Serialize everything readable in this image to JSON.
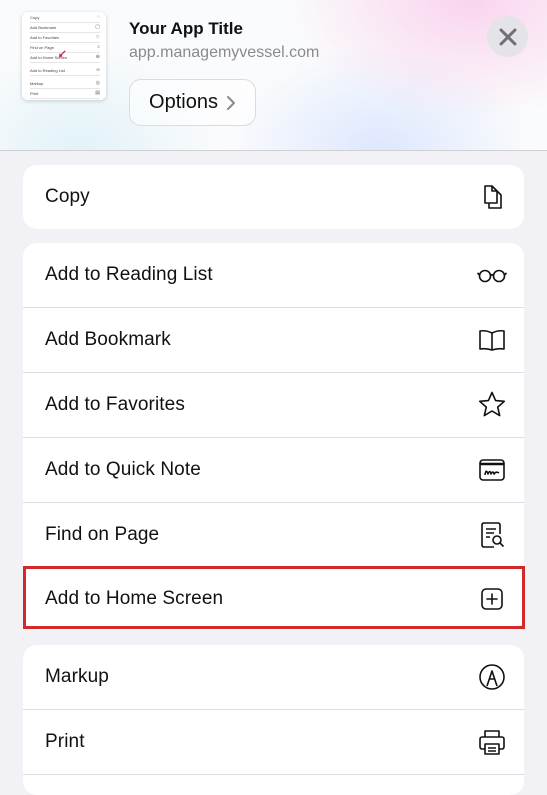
{
  "header": {
    "app_title": "Your App Title",
    "app_url": "app.managemyvessel.com",
    "options_label": "Options",
    "thumbnail": {
      "rows": [
        "Copy",
        "Add Bookmark",
        "Add to Favorites",
        "Find on Page",
        "Add to Home Screen",
        "Add to Reading List",
        "Markup",
        "Print"
      ]
    }
  },
  "groups": [
    {
      "items": [
        {
          "label": "Copy",
          "icon": "copy-icon"
        }
      ]
    },
    {
      "items": [
        {
          "label": "Add to Reading List",
          "icon": "glasses-icon"
        },
        {
          "label": "Add Bookmark",
          "icon": "book-icon"
        },
        {
          "label": "Add to Favorites",
          "icon": "star-icon"
        },
        {
          "label": "Add to Quick Note",
          "icon": "quick-note-icon"
        },
        {
          "label": "Find on Page",
          "icon": "find-on-page-icon"
        },
        {
          "label": "Add to Home Screen",
          "icon": "plus-square-icon"
        }
      ]
    },
    {
      "items": [
        {
          "label": "Markup",
          "icon": "markup-pen-icon"
        },
        {
          "label": "Print",
          "icon": "printer-icon"
        }
      ]
    }
  ],
  "colors": {
    "highlight": "#d22a2a",
    "background": "#f2f2f6"
  }
}
